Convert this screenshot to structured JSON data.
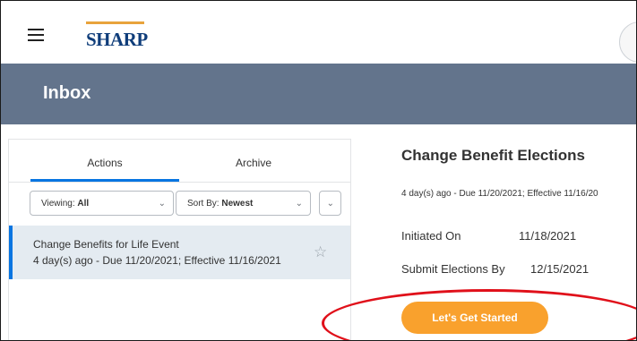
{
  "topbar": {
    "logo_text": "SHARP",
    "menu_icon": "hamburger-menu-icon",
    "brand_colors": {
      "logo_blue": "#0f3d7a",
      "logo_accent": "#e8a33c"
    }
  },
  "header": {
    "title": "Inbox",
    "band_color": "#63748c"
  },
  "tabs": {
    "actions": "Actions",
    "archive": "Archive",
    "active": "Actions"
  },
  "filters": {
    "viewing_label": "Viewing:",
    "viewing_value": "All",
    "sort_label": "Sort By:",
    "sort_value": "Newest"
  },
  "inbox_items": [
    {
      "title": "Change Benefits for Life Event",
      "subtitle": "4 day(s) ago - Due 11/20/2021; Effective 11/16/2021",
      "selected": true
    }
  ],
  "detail": {
    "title": "Change Benefit Elections",
    "subtitle": "4 day(s) ago - Due 11/20/2021; Effective 11/16/20",
    "fields": [
      {
        "label": "Initiated On",
        "value": "11/18/2021"
      },
      {
        "label": "Submit Elections By",
        "value": "12/15/2021"
      }
    ],
    "cta_label": "Let's Get Started"
  },
  "colors": {
    "accent_blue": "#0875e1",
    "cta_orange": "#f9a12d",
    "highlight_red": "#e0101a"
  }
}
